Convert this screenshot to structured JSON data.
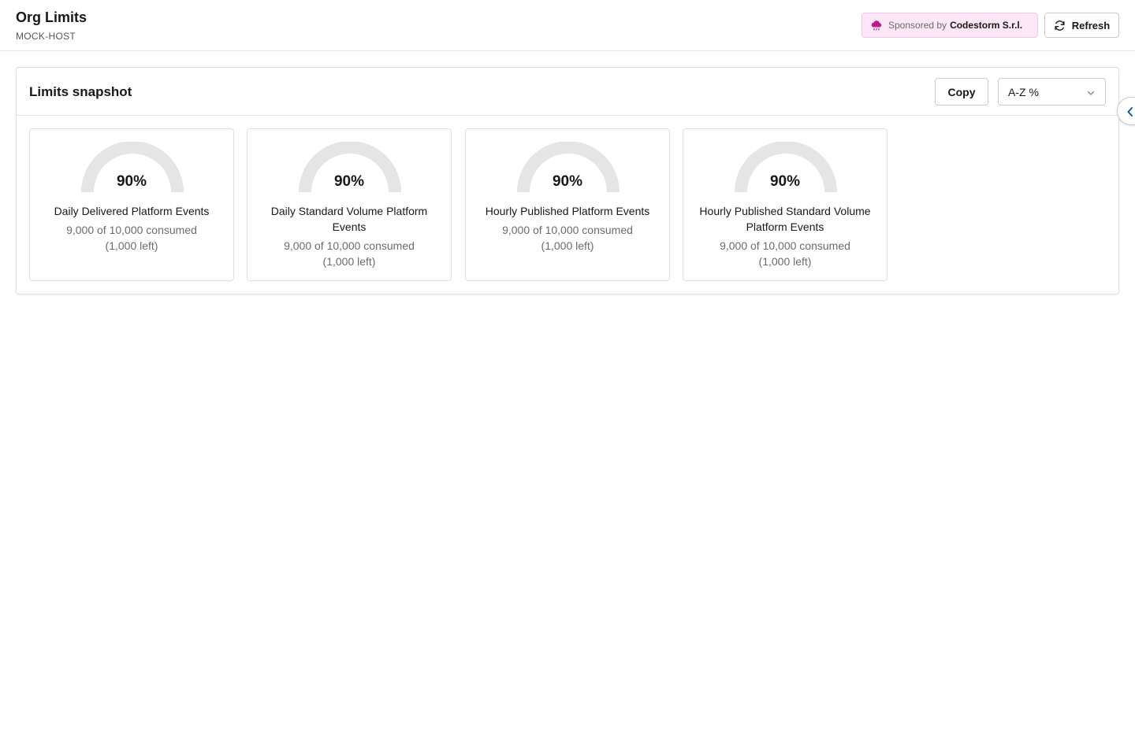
{
  "header": {
    "title": "Org Limits",
    "subtitle": "MOCK-HOST",
    "sponsor_prefix": "Sponsored by",
    "sponsor_name": "Codestorm S.r.l.",
    "refresh_label": "Refresh"
  },
  "snapshot": {
    "title": "Limits snapshot",
    "copy_label": "Copy",
    "sort_value": "A-Z %"
  },
  "limits": [
    {
      "percent": "90%",
      "fraction": 0.9,
      "name": "Daily Delivered Platform Events",
      "usage_line1": "9,000 of 10,000 consumed",
      "usage_line2": "(1,000 left)"
    },
    {
      "percent": "90%",
      "fraction": 0.9,
      "name": "Daily Standard Volume Platform Events",
      "usage_line1": "9,000 of 10,000 consumed",
      "usage_line2": "(1,000 left)"
    },
    {
      "percent": "90%",
      "fraction": 0.9,
      "name": "Hourly Published Platform Events",
      "usage_line1": "9,000 of 10,000 consumed",
      "usage_line2": "(1,000 left)"
    },
    {
      "percent": "90%",
      "fraction": 0.9,
      "name": "Hourly Published Standard Volume Platform Events",
      "usage_line1": "9,000 of 10,000 consumed",
      "usage_line2": "(1,000 left)"
    }
  ],
  "colors": {
    "gauge_track": "#e5e5e5",
    "sponsor_bg": "#fbe7f6",
    "sponsor_icon": "#c2188f",
    "accent": "#0b5cab"
  },
  "icons": {
    "sponsor": "cloud-code-icon",
    "refresh": "refresh-icon",
    "sort": "chevron-down-icon",
    "panel_toggle": "chevron-left-icon"
  }
}
